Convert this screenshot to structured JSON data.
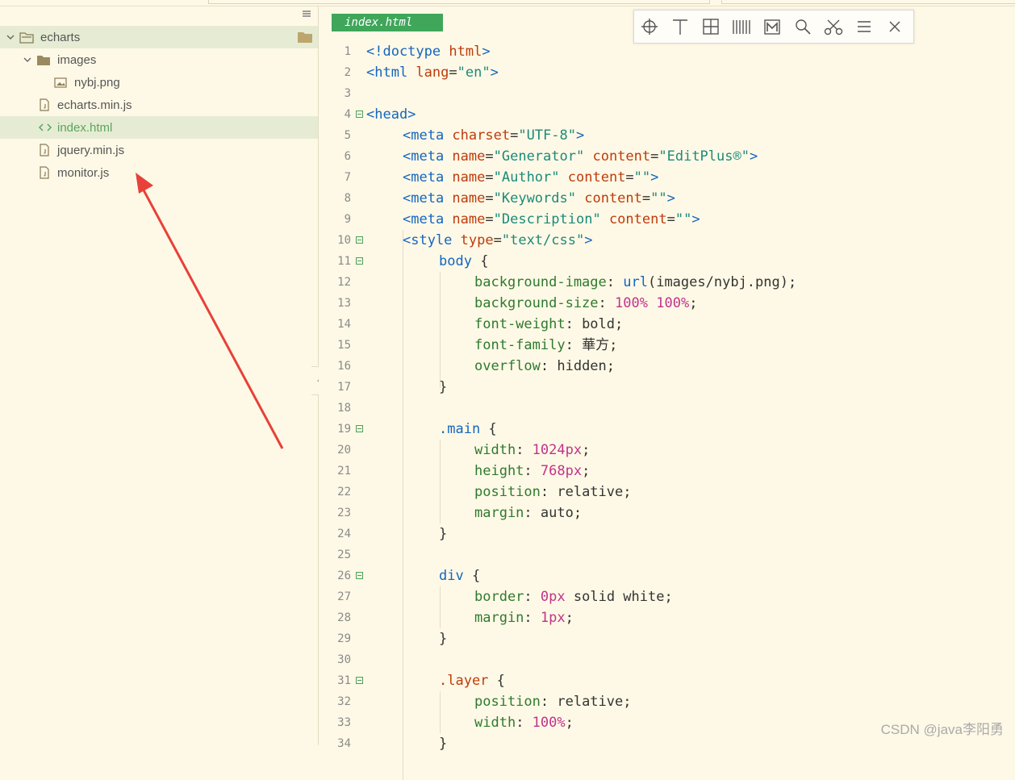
{
  "sidebar": {
    "items": [
      {
        "label": "echarts"
      },
      {
        "label": "images"
      },
      {
        "label": "nybj.png"
      },
      {
        "label": "echarts.min.js"
      },
      {
        "label": "index.html"
      },
      {
        "label": "jquery.min.js"
      },
      {
        "label": "monitor.js"
      }
    ]
  },
  "editor": {
    "tab_label": "index.html",
    "toolbar_icons": [
      "crosshair-icon",
      "text-icon",
      "grid-icon",
      "columns-icon",
      "mosaic-icon",
      "search-icon",
      "scissors-icon",
      "menu-icon",
      "close-icon"
    ],
    "lines": [
      {
        "n": "1"
      },
      {
        "n": "2"
      },
      {
        "n": "3"
      },
      {
        "n": "4"
      },
      {
        "n": "5"
      },
      {
        "n": "6"
      },
      {
        "n": "7"
      },
      {
        "n": "8"
      },
      {
        "n": "9"
      },
      {
        "n": "10"
      },
      {
        "n": "11"
      },
      {
        "n": "12"
      },
      {
        "n": "13"
      },
      {
        "n": "14"
      },
      {
        "n": "15"
      },
      {
        "n": "16"
      },
      {
        "n": "17"
      },
      {
        "n": "18"
      },
      {
        "n": "19"
      },
      {
        "n": "20"
      },
      {
        "n": "21"
      },
      {
        "n": "22"
      },
      {
        "n": "23"
      },
      {
        "n": "24"
      },
      {
        "n": "25"
      },
      {
        "n": "26"
      },
      {
        "n": "27"
      },
      {
        "n": "28"
      },
      {
        "n": "29"
      },
      {
        "n": "30"
      },
      {
        "n": "31"
      },
      {
        "n": "32"
      },
      {
        "n": "33"
      },
      {
        "n": "34"
      }
    ],
    "code": {
      "l1": [
        "<!doctype ",
        "html",
        ">"
      ],
      "l2": [
        "<html ",
        "lang",
        "=",
        "\"en\"",
        ">"
      ],
      "l4": [
        "<head>"
      ],
      "l5": [
        "<meta ",
        "charset",
        "=",
        "\"UTF-8\"",
        ">"
      ],
      "l6": [
        "<meta ",
        "name",
        "=",
        "\"Generator\"",
        " ",
        "content",
        "=",
        "\"EditPlus®\"",
        ">"
      ],
      "l7": [
        "<meta ",
        "name",
        "=",
        "\"Author\"",
        " ",
        "content",
        "=",
        "\"\"",
        ">"
      ],
      "l8": [
        "<meta ",
        "name",
        "=",
        "\"Keywords\"",
        " ",
        "content",
        "=",
        "\"\"",
        ">"
      ],
      "l9": [
        "<meta ",
        "name",
        "=",
        "\"Description\"",
        " ",
        "content",
        "=",
        "\"\"",
        ">"
      ],
      "l10": [
        "<style ",
        "type",
        "=",
        "\"text/css\"",
        ">"
      ],
      "l11": [
        "body",
        " {"
      ],
      "l12": [
        "background-image",
        ": ",
        "url",
        "(images/nybj.png);"
      ],
      "l13": [
        "background-size",
        ": ",
        "100",
        "%",
        " ",
        "100",
        "%",
        ";"
      ],
      "l14": [
        "font-weight",
        ": bold;"
      ],
      "l15": [
        "font-family",
        ": 華方;"
      ],
      "l16": [
        "overflow",
        ": hidden;"
      ],
      "l17": [
        "}"
      ],
      "l19": [
        ".main",
        " {"
      ],
      "l20": [
        "width",
        ": ",
        "1024",
        "px",
        ";"
      ],
      "l21": [
        "height",
        ": ",
        "768",
        "px",
        ";"
      ],
      "l22": [
        "position",
        ": relative;"
      ],
      "l23": [
        "margin",
        ": auto;"
      ],
      "l24": [
        "}"
      ],
      "l26": [
        "div",
        " {"
      ],
      "l27": [
        "border",
        ": ",
        "0",
        "px",
        " solid white;"
      ],
      "l28": [
        "margin",
        ": ",
        "1",
        "px",
        ";"
      ],
      "l29": [
        "}"
      ],
      "l31": [
        ".layer",
        " {"
      ],
      "l32": [
        "position",
        ": relative;"
      ],
      "l33": [
        "width",
        ": ",
        "100",
        "%",
        ";"
      ],
      "l34": [
        "}"
      ]
    }
  },
  "watermark": "CSDN @java李阳勇"
}
